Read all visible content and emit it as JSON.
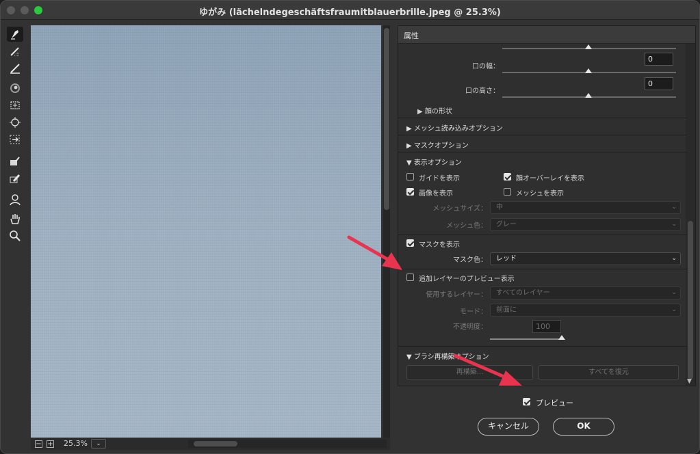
{
  "window": {
    "title": "ゆがみ (lächelndegeschäftsfraumitblauerbrille.jpeg @ 25.3%)"
  },
  "tools": [
    "forward-warp-tool",
    "reconstruct-tool",
    "smooth-tool",
    "twirl-tool",
    "pucker-tool",
    "bloat-tool",
    "push-left-tool",
    "freeze-mask-tool",
    "thaw-mask-tool",
    "face-tool",
    "hand-tool",
    "zoom-tool"
  ],
  "status": {
    "zoom": "25.3%",
    "zoom_out": "−",
    "zoom_in": "+",
    "chevron": "⌄"
  },
  "panel": {
    "title": "属性",
    "mouth_width": {
      "label": "口の幅：",
      "value": "0"
    },
    "mouth_height": {
      "label": "口の高さ：",
      "value": "0"
    },
    "face_shape": "▶  顔の形状",
    "load_mesh": "▶  メッシュ読み込みオプション",
    "mask_options": "▶  マスクオプション",
    "view_options": "▼  表示オプション",
    "show_guides": "ガイドを表示",
    "show_face_overlay": "顔オーバーレイを表示",
    "show_image": "画像を表示",
    "show_mesh": "メッシュを表示",
    "mesh_size": {
      "label": "メッシュサイズ：",
      "value": "中"
    },
    "mesh_color": {
      "label": "メッシュ色：",
      "value": "グレー"
    },
    "show_mask": "マスクを表示",
    "mask_color": {
      "label": "マスク色：",
      "value": "レッド"
    },
    "show_backdrop": "追加レイヤーのプレビュー表示",
    "use_layer": {
      "label": "使用するレイヤー：",
      "value": "すべてのレイヤー"
    },
    "mode": {
      "label": "モード：",
      "value": "前面に"
    },
    "opacity": {
      "label": "不透明度：",
      "value": "100"
    },
    "brush_reconstruct": "▼  ブラシ再構築オプション",
    "reconstruct_btn": "再構築...",
    "restore_all_btn": "すべてを復元",
    "scroll_down": "▼"
  },
  "preview_label": "プレビュー",
  "cancel_label": "キャンセル",
  "ok_label": "OK",
  "colors": {
    "annotation_arrow": "#e8344e",
    "canvas": "#9aacbd"
  },
  "checked": {
    "show_guides": false,
    "show_face_overlay": true,
    "show_image": true,
    "show_mesh": false,
    "show_mask": true,
    "show_backdrop": false,
    "preview": true
  }
}
